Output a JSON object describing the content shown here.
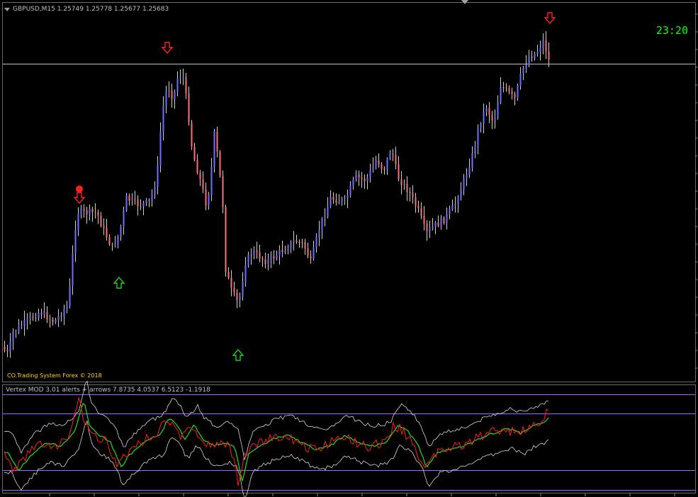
{
  "header": {
    "symbol_info": "GBPUSD,M15  1.25749 1.25778 1.25677 1.25683",
    "clock": "23:20"
  },
  "watermark": "CO.Trading System Forex © 2018",
  "indicator": {
    "label": "Vertex MOD 3.01 alerts + arrows 7.8735 4.0537 6.5123 -1.1918"
  },
  "colors": {
    "background": "#000000",
    "bull_candle": "#6f6fff",
    "bear_candle": "#ff7070",
    "wick": "#cfcfcf",
    "price_line": "#c0c0c0",
    "sell_arrow": "#ff2020",
    "buy_arrow": "#22cc22",
    "osc_red": "#ff1e1e",
    "osc_green": "#22dd22",
    "osc_band": "#d8d8d8",
    "level_lines": "#b060ff",
    "clock": "#00ff00",
    "watermark": "#ffd700"
  },
  "icons": {
    "sell": "down-arrow-icon",
    "buy": "up-arrow-icon",
    "alert": "red-dot-icon"
  }
}
